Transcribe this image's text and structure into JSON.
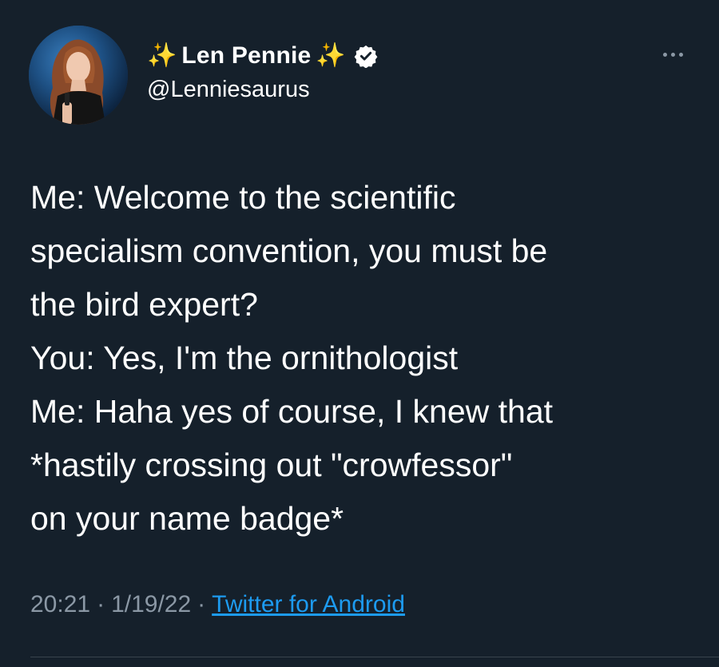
{
  "author": {
    "sparkle_left": "✨",
    "display_name": "Len Pennie",
    "sparkle_right": "✨",
    "handle": "@Lenniesaurus",
    "verified": true
  },
  "tweet": {
    "lines": [
      "Me: Welcome to the scientific",
      "specialism convention, you must be",
      "the bird expert?",
      "You: Yes, I'm the ornithologist",
      "Me: Haha yes of course, I knew that",
      "*hastily crossing out \"crowfessor\"",
      "on your name badge*"
    ]
  },
  "meta": {
    "time": "20:21",
    "sep1": "·",
    "date": "1/19/22",
    "sep2": "·",
    "source": "Twitter for Android"
  },
  "icons": {
    "more": "more-options-icon",
    "verified": "verified-badge-icon"
  },
  "colors": {
    "background": "#15202b",
    "text": "#ffffff",
    "secondary": "#8b98a5",
    "link": "#1d9bf0",
    "sparkle": "#f7c948"
  }
}
